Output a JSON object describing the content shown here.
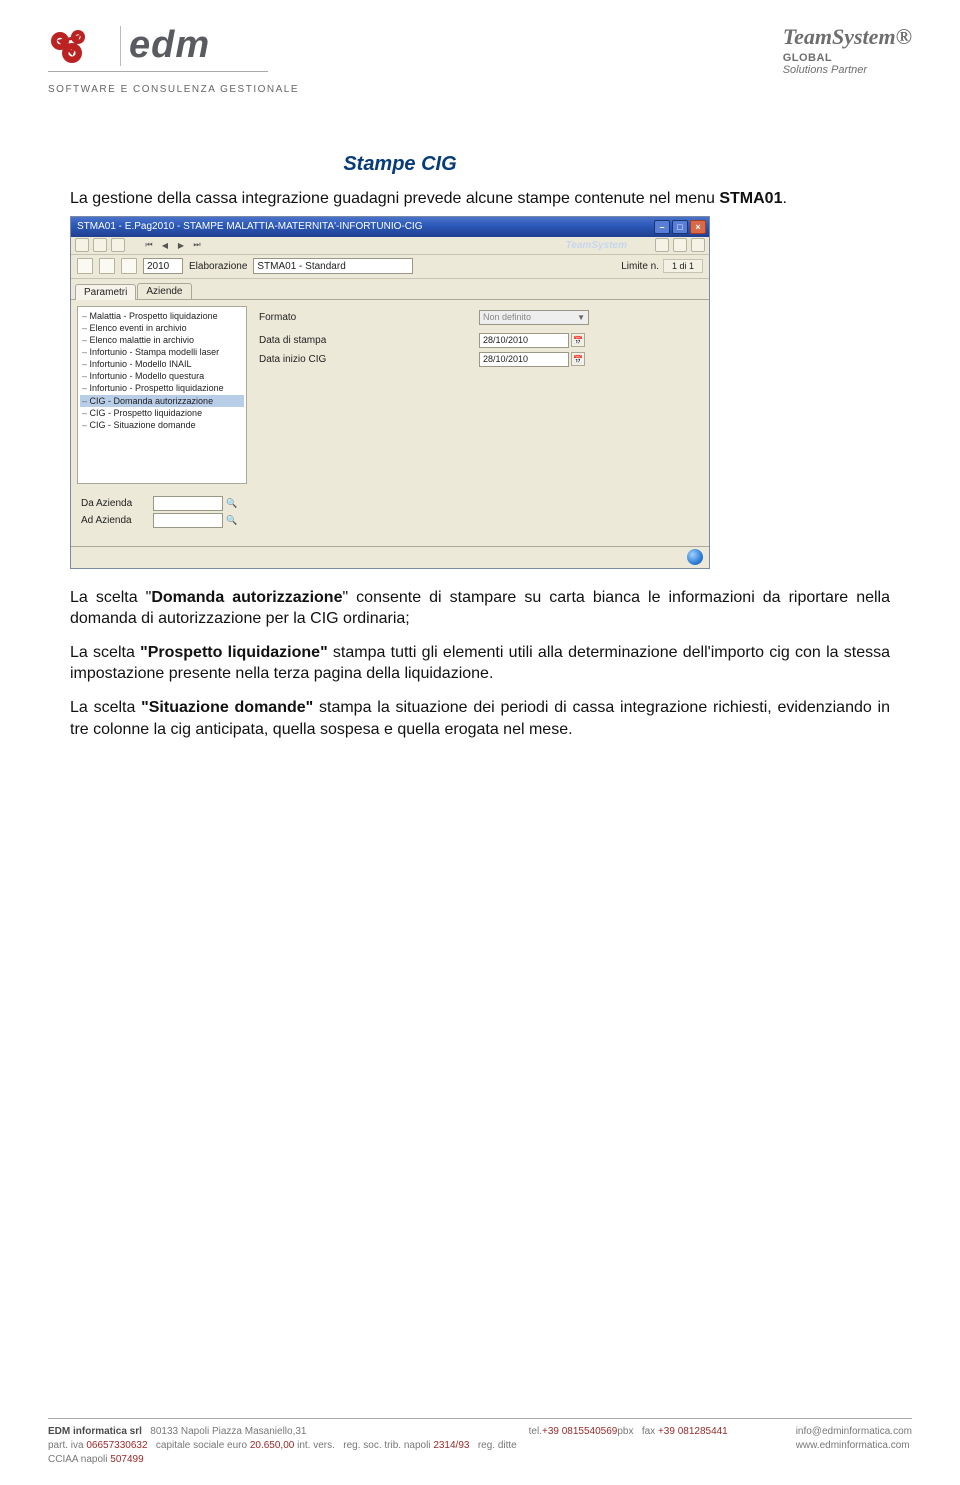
{
  "header": {
    "edm_text": "edm",
    "edm_sub": "SOFTWARE E CONSULENZA GESTIONALE",
    "ts_top": "TeamSystem",
    "ts_sub1": "GLOBAL",
    "ts_sub2": "Solutions Partner"
  },
  "content": {
    "title": "Stampe CIG",
    "p1_pre": "La gestione della cassa integrazione guadagni prevede alcune stampe contenute nel menu ",
    "p1_code": "STMA01",
    "p1_post": ".",
    "p2_pre": "La scelta \"",
    "p2_b": "Domanda autorizzazione",
    "p2_post": "\" consente di stampare su carta bianca le informazioni da riportare nella domanda di autorizzazione per la CIG ordinaria;",
    "p3_pre": "La scelta ",
    "p3_b": "\"Prospetto liquidazione\"",
    "p3_post": " stampa tutti gli elementi utili alla determinazione dell'importo cig con la stessa impostazione presente nella terza pagina della liquidazione.",
    "p4_pre": "La scelta ",
    "p4_b": "\"Situazione domande\"",
    "p4_post": " stampa la situazione dei periodi di cassa integrazione richiesti, evidenziando in tre colonne la cig anticipata, quella sospesa e quella erogata nel mese."
  },
  "app": {
    "title": "STMA01 - E.Pag2010 - STAMPE MALATTIA-MATERNITA'-INFORTUNIO-CIG",
    "brand_in_menu": "TeamSystem",
    "toolbar": {
      "year": "2010",
      "label_elab": "Elaborazione",
      "combo_value": "STMA01 - Standard",
      "limit_label": "Limite n.",
      "limit_value": "1 di 1"
    },
    "tabs": {
      "t0": "Parametri",
      "t1": "Aziende"
    },
    "tree": {
      "i0": "Malattia - Prospetto liquidazione",
      "i1": "Elenco eventi in archivio",
      "i2": "Elenco malattie in archivio",
      "i3": "Infortunio - Stampa modelli laser",
      "i4": "Infortunio - Modello INAIL",
      "i5": "Infortunio - Modello questura",
      "i6": "Infortunio - Prospetto liquidazione",
      "i7": "CIG - Domanda autorizzazione",
      "i8": "CIG - Prospetto liquidazione",
      "i9": "CIG - Situazione domande"
    },
    "form": {
      "formato_label": "Formato",
      "formato_value": "Non definito",
      "row1_label": "Data di stampa",
      "row1_value": "28/10/2010",
      "row2_label": "Data inizio CIG",
      "row2_value": "28/10/2010"
    },
    "azienda": {
      "from_label": "Da Azienda",
      "to_label": "Ad Azienda"
    }
  },
  "footer": {
    "col1_l1a": "EDM informatica srl",
    "col1_l1b": "80133 Napoli Piazza Masaniello,31",
    "col1_l2a": "part. iva",
    "col1_l2b": "06657330632",
    "col1_l2c": "capitale sociale euro",
    "col1_l2d": "20.650,00",
    "col1_l2e": "int. vers.",
    "col1_l2f": "reg. soc. trib. napoli",
    "col1_l2g": "2314/93",
    "col1_l2h": "reg. ditte CCIAA napoli",
    "col1_l2i": "507499",
    "col2_l1a": "tel.",
    "col2_l1b": "+39 0815540569",
    "col2_l1c": "pbx",
    "col2_l1d": "fax",
    "col2_l1e": "+39 081285441",
    "col3_l1": "info@edminformatica.com",
    "col3_l2": "www.edminformatica.com"
  }
}
